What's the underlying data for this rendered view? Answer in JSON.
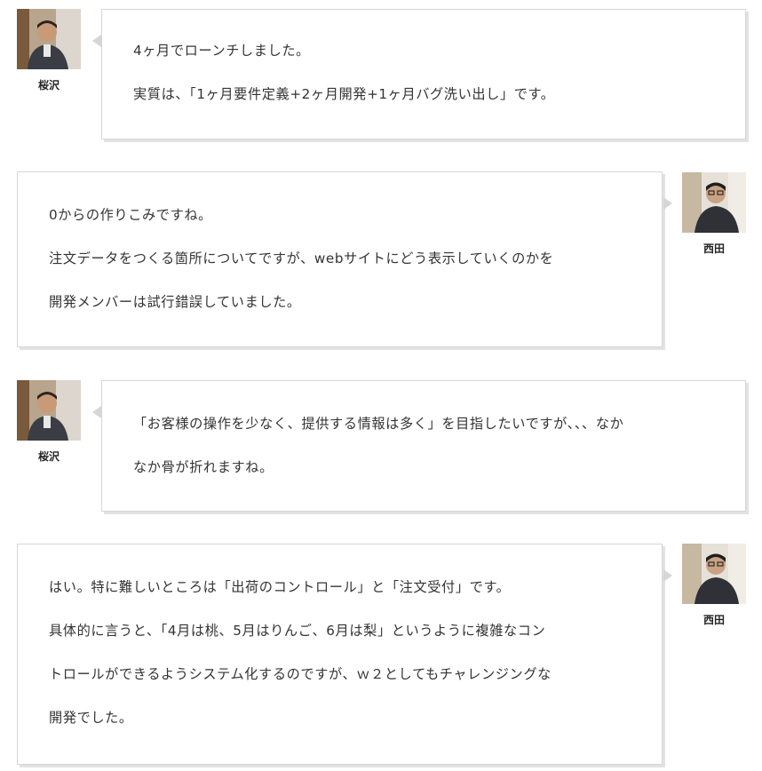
{
  "dialogue": [
    {
      "speaker": "桜沢",
      "side": "left",
      "lines": [
        "4ヶ月でローンチしました。",
        "実質は、「1ヶ月要件定義+2ヶ月開発+1ヶ月バグ洗い出し」です。"
      ]
    },
    {
      "speaker": "西田",
      "side": "right",
      "lines": [
        "0からの作りこみですね。",
        "注文データをつくる箇所についてですが、webサイトにどう表示していくのかを",
        "開発メンバーは試行錯誤していました。"
      ]
    },
    {
      "speaker": "桜沢",
      "side": "left",
      "lines": [
        "「お客様の操作を少なく、提供する情報は多く」を目指したいですが、、、なか",
        "なか骨が折れますね。"
      ]
    },
    {
      "speaker": "西田",
      "side": "right",
      "lines": [
        "はい。特に難しいところは「出荷のコントロール」と「注文受付」です。",
        "具体的に言うと、「4月は桃、5月はりんご、6月は梨」というように複雑なコン",
        "トロールができるようシステム化するのですが、ｗ２としてもチャレンジングな",
        "開発でした。"
      ]
    }
  ]
}
